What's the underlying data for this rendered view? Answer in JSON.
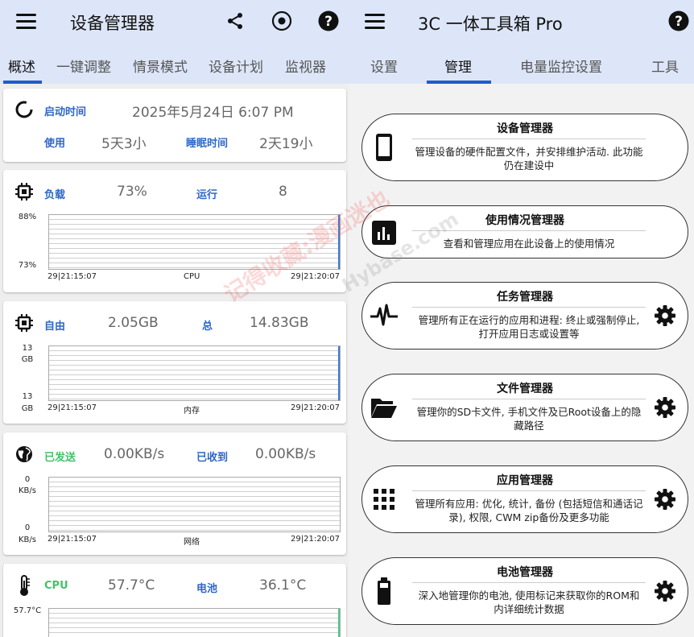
{
  "left": {
    "title": "设备管理器",
    "tabs": [
      "概述",
      "一键调整",
      "情景模式",
      "设备计划",
      "监视器"
    ],
    "uptime": {
      "label": "启动时间",
      "value": "2025年5月24日 6:07 PM",
      "use_label": "使用",
      "use_value": "5天3小",
      "sleep_label": "睡眠时间",
      "sleep_value": "2天19小"
    },
    "cpu": {
      "load_label": "负载",
      "load_value": "73%",
      "run_label": "运行",
      "run_value": "8",
      "y_top": "88%",
      "y_bottom": "73%",
      "x_start": "29|21:15:07",
      "x_mid": "CPU",
      "x_end": "29|21:20:07"
    },
    "mem": {
      "free_label": "自由",
      "free_value": "2.05GB",
      "total_label": "总",
      "total_value": "14.83GB",
      "y_top_1": "13",
      "y_top_2": "GB",
      "y_bottom_1": "13",
      "y_bottom_2": "GB",
      "x_start": "29|21:15:07",
      "x_mid": "内存",
      "x_end": "29|21:20:07"
    },
    "net": {
      "sent_label": "已发送",
      "sent_value": "0.00KB/s",
      "recv_label": "已收到",
      "recv_value": "0.00KB/s",
      "y_top_1": "0",
      "y_top_2": "KB/s",
      "y_bottom_1": "0",
      "y_bottom_2": "KB/s",
      "x_start": "29|21:15:07",
      "x_mid": "网络",
      "x_end": "29|21:20:07"
    },
    "temp": {
      "cpu_label": "CPU",
      "cpu_value": "57.7°C",
      "bat_label": "电池",
      "bat_value": "36.1°C",
      "y_top": "57.7°C"
    }
  },
  "right": {
    "title": "3C 一体工具箱 Pro",
    "tabs": [
      "设置",
      "管理",
      "电量监控设置",
      "工具"
    ],
    "cards": [
      {
        "title": "设备管理器",
        "desc": "管理设备的硬件配置文件，并安排维护活动. 此功能仍在建设中",
        "icon": "phone-icon",
        "gear": false
      },
      {
        "title": "使用情况管理器",
        "desc": "查看和管理应用在此设备上的使用情况",
        "icon": "bar-chart-icon",
        "gear": false
      },
      {
        "title": "任务管理器",
        "desc": "管理所有正在运行的应用和进程: 终止或强制停止, 打开应用日志或设置等",
        "icon": "pulse-icon",
        "gear": true
      },
      {
        "title": "文件管理器",
        "desc": "管理你的SD卡文件, 手机文件及已Root设备上的隐藏路径",
        "icon": "folder-icon",
        "gear": true
      },
      {
        "title": "应用管理器",
        "desc": "管理所有应用: 优化, 统计, 备份 (包括短信和通话记录), 权限, CWM zip备份及更多功能",
        "icon": "grid-icon",
        "gear": true
      },
      {
        "title": "电池管理器",
        "desc": "深入地管理你的电池, 使用标记来获取你的ROM和内详细统计数据",
        "icon": "battery-icon",
        "gear": true
      }
    ]
  },
  "watermark": {
    "text1": "记得收藏:漫画迷也",
    "text2": "Hybase.com"
  },
  "colors": {
    "appbar": "#dde6f8",
    "accent": "#1f5cc9",
    "label_blue": "#2f67c8",
    "label_green": "#42c36a"
  }
}
